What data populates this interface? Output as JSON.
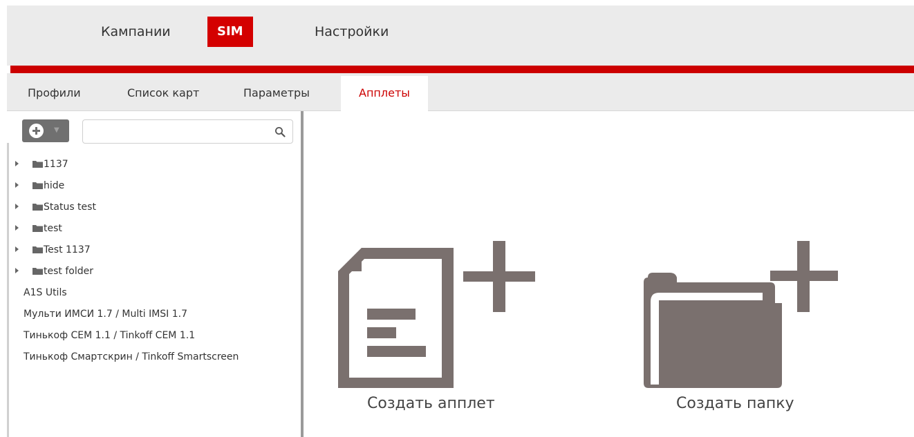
{
  "topnav": {
    "tabs": [
      {
        "label": "Кампании"
      },
      {
        "label": "SIM"
      },
      {
        "label": "Настройки"
      }
    ]
  },
  "subnav": {
    "tabs": [
      {
        "label": "Профили"
      },
      {
        "label": "Список карт"
      },
      {
        "label": "Параметры"
      },
      {
        "label": "Апплеты"
      }
    ]
  },
  "search": {
    "value": "",
    "placeholder": ""
  },
  "tree": {
    "folders": [
      {
        "label": "1137"
      },
      {
        "label": "hide"
      },
      {
        "label": "Status test"
      },
      {
        "label": "test"
      },
      {
        "label": "Test 1137"
      },
      {
        "label": "test folder"
      }
    ],
    "items": [
      {
        "label": "A1S Utils"
      },
      {
        "label": "Мульти ИМСИ 1.7 / Multi IMSI 1.7"
      },
      {
        "label": "Тинькоф CEM 1.1 / Tinkoff CEM 1.1"
      },
      {
        "label": "Тинькоф Смартскрин / Tinkoff Smartscreen"
      }
    ]
  },
  "actions": {
    "create_applet": "Создать апплет",
    "create_folder": "Создать папку"
  },
  "colors": {
    "accent": "#cc0000",
    "icon_gray": "#7a706e",
    "nav_bg": "#ebebeb"
  }
}
